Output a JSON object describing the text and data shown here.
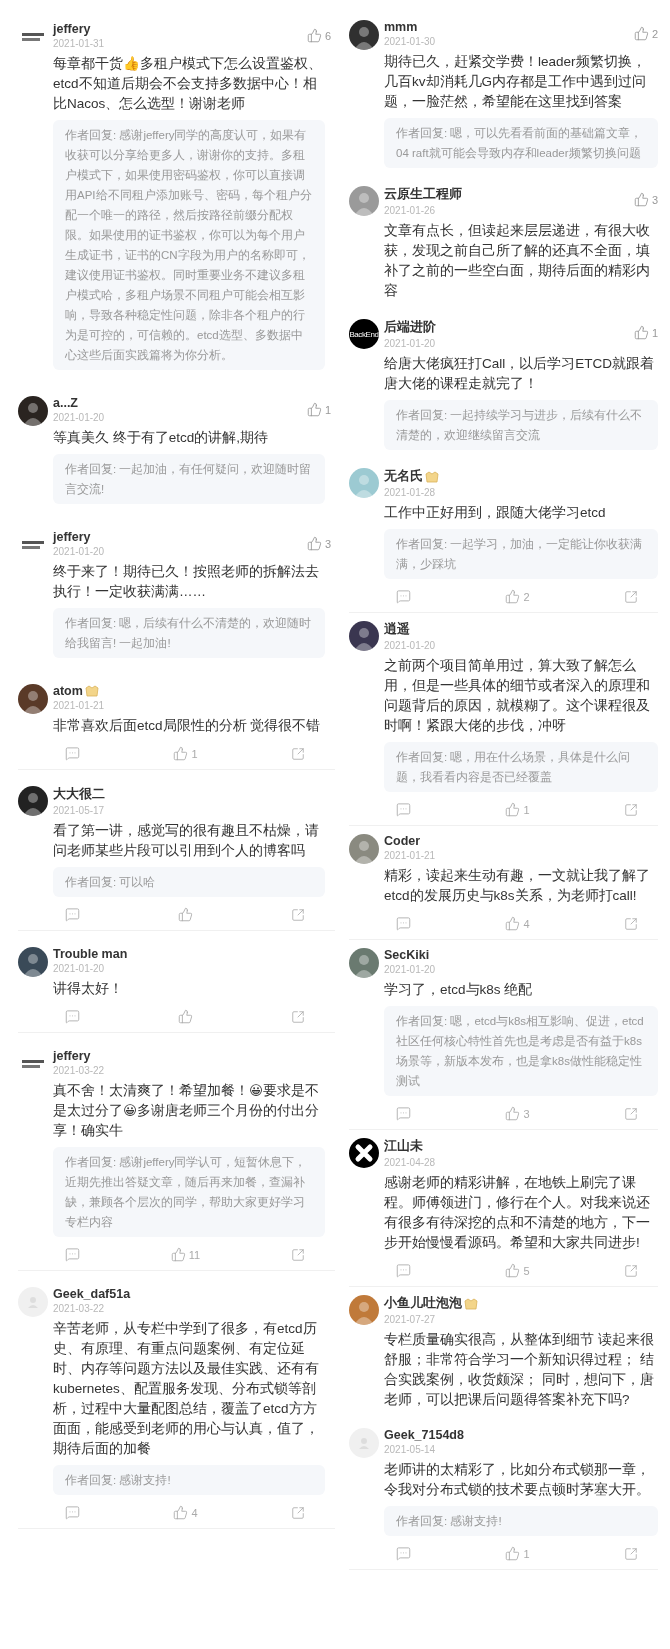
{
  "columns": [
    {
      "comments": [
        {
          "author": "jeffery",
          "badge": false,
          "date": "2021-01-31",
          "avatar": {
            "kind": "wordmark"
          },
          "header_likes": "6",
          "footer": false,
          "text": "每章都干货👍多租户模式下怎么设置鉴权、etcd不知道后期会不会支持多数据中心！相比Nacos、怎么选型！谢谢老师",
          "reply": "作者回复: 感谢jeffery同学的高度认可，如果有收获可以分享给更多人，谢谢你的支持。多租户模式下，如果使用密码鉴权，你可以直接调用API给不同租户添加账号、密码，每个租户分配一个唯一的路径，然后按路径前缀分配权限。如果使用的证书鉴权，你可以为每个用户生成证书，证书的CN字段为用户的名称即可，建议使用证书鉴权。同时重要业务不建议多租户模式哈，多租户场景不同租户可能会相互影响，导致各种稳定性问题，除非各个租户的行为是可控的，可信赖的。etcd选型、多数据中心这些后面实践篇将为你分析。"
        },
        {
          "author": "a...Z",
          "badge": false,
          "date": "2021-01-20",
          "avatar": {
            "kind": "photo",
            "color": "#2a2420"
          },
          "header_likes": "1",
          "footer": false,
          "text": "等真美久 终于有了etcd的讲解,期待",
          "reply": "作者回复: 一起加油，有任何疑问，欢迎随时留言交流!"
        },
        {
          "author": "jeffery",
          "badge": false,
          "date": "2021-01-20",
          "avatar": {
            "kind": "wordmark"
          },
          "header_likes": "3",
          "footer": false,
          "text": "终于来了！期待已久！按照老师的拆解法去执行！一定收获满满……",
          "reply": "作者回复: 嗯，后续有什么不清楚的，欢迎随时给我留言! 一起加油!"
        },
        {
          "author": "atom",
          "badge": true,
          "date": "2021-01-21",
          "avatar": {
            "kind": "photo",
            "color": "#5a3a28"
          },
          "text": "非常喜欢后面etcd局限性的分析 觉得很不错",
          "footer": true,
          "footer_likes": "1"
        },
        {
          "author": "大大很二",
          "badge": false,
          "date": "2021-05-17",
          "avatar": {
            "kind": "photo",
            "color": "#222222"
          },
          "text": "看了第一讲，感觉写的很有趣且不枯燥，请问老师某些片段可以引用到个人的博客吗",
          "reply": "作者回复: 可以哈",
          "footer": true
        },
        {
          "author": "Trouble man",
          "badge": false,
          "date": "2021-01-20",
          "avatar": {
            "kind": "photo",
            "color": "#3a4a58"
          },
          "text": "讲得太好！",
          "footer": true
        },
        {
          "author": "jeffery",
          "badge": false,
          "date": "2021-03-22",
          "avatar": {
            "kind": "wordmark"
          },
          "text": "真不舍！太清爽了！希望加餐！😀要求是不是太过分了😀多谢唐老师三个月份的付出分享！确实牛",
          "reply": "作者回复: 感谢jeffery同学认可，短暂休息下，近期先推出答疑文章，随后再来加餐，查漏补缺，兼顾各个层次的同学，帮助大家更好学习专栏内容",
          "footer": true,
          "footer_likes": "11"
        },
        {
          "author": "Geek_daf51a",
          "badge": false,
          "date": "2021-03-22",
          "avatar": {
            "kind": "default"
          },
          "text": "辛苦老师，从专栏中学到了很多，有etcd历史、有原理、有重点问题案例、有定位延时、内存等问题方法以及最佳实践、还有有kubernetes、配置服务发现、分布式锁等剖析，过程中大量配图总结，覆盖了etcd方方面面，能感受到老师的用心与认真，值了，期待后面的加餐",
          "reply": "作者回复: 感谢支持!",
          "footer": true,
          "footer_likes": "4"
        }
      ]
    },
    {
      "comments": [
        {
          "author": "mmm",
          "badge": false,
          "date": "2021-01-30",
          "avatar": {
            "kind": "photo",
            "color": "#303030"
          },
          "header_likes": "2",
          "footer": false,
          "text": "期待已久，赶紧交学费！leader频繁切换，几百kv却消耗几G内存都是工作中遇到过问题，一脸茫然，希望能在这里找到答案",
          "reply": "作者回复: 嗯，可以先看看前面的基础篇文章，04 raft就可能会导致内存和leader频繁切换问题"
        },
        {
          "author": "云原生工程师",
          "badge": false,
          "date": "2021-01-26",
          "avatar": {
            "kind": "photo",
            "color": "#9a9a9a"
          },
          "header_likes": "3",
          "footer": false,
          "text": "文章有点长，但读起来层层递进，有很大收获，发现之前自己所了解的还真不全面，填补了之前的一些空白面，期待后面的精彩内容"
        },
        {
          "author": "后端进阶",
          "badge": false,
          "date": "2021-01-20",
          "avatar": {
            "kind": "logo",
            "label": "BackEnd"
          },
          "header_likes": "1",
          "footer": false,
          "text": "给唐大佬疯狂打Call，以后学习ETCD就跟着唐大佬的课程走就完了！",
          "reply": "作者回复: 一起持续学习与进步，后续有什么不清楚的，欢迎继续留言交流"
        },
        {
          "author": "无名氏",
          "badge": true,
          "date": "2021-01-28",
          "avatar": {
            "kind": "photo",
            "color": "#9ccad2"
          },
          "text": "工作中正好用到，跟随大佬学习etcd",
          "reply": "作者回复: 一起学习，加油，一定能让你收获满满，少踩坑",
          "footer": true,
          "footer_likes": "2"
        },
        {
          "author": "逍遥",
          "badge": false,
          "date": "2021-01-20",
          "avatar": {
            "kind": "photo",
            "color": "#3a3650"
          },
          "text": "之前两个项目简单用过，算大致了解怎么用，但是一些具体的细节或者深入的原理和问题背后的原因，就模糊了。这个课程很及时啊！紧跟大佬的步伐，冲呀",
          "reply": "作者回复: 嗯，用在什么场景，具体是什么问题，我看看内容是否已经覆盖",
          "footer": true,
          "footer_likes": "1"
        },
        {
          "author": "Coder",
          "badge": false,
          "date": "2021-01-21",
          "avatar": {
            "kind": "photo",
            "color": "#8a8a80"
          },
          "text": "精彩，读起来生动有趣，一文就让我了解了etcd的发展历史与k8s关系，为老师打call!",
          "footer": true,
          "footer_likes": "4"
        },
        {
          "author": "SecKiki",
          "badge": false,
          "date": "2021-01-20",
          "avatar": {
            "kind": "photo",
            "color": "#6a7a70"
          },
          "text": "学习了，etcd与k8s 绝配",
          "reply": "作者回复: 嗯，etcd与k8s相互影响、促进，etcd社区任何核心特性首先也是考虑是否有益于k8s场景等，新版本发布，也是拿k8s做性能稳定性测试",
          "footer": true,
          "footer_likes": "3"
        },
        {
          "author": "江山未",
          "badge": false,
          "date": "2021-04-28",
          "avatar": {
            "kind": "cross"
          },
          "text": "感谢老师的精彩讲解，在地铁上刷完了课程。师傅领进门，修行在个人。对我来说还有很多有待深挖的点和不清楚的地方，下一步开始慢慢看源码。希望和大家共同进步!",
          "footer": true,
          "footer_likes": "5"
        },
        {
          "author": "小鱼儿吐泡泡",
          "badge": true,
          "date": "2021-07-27",
          "avatar": {
            "kind": "photo",
            "color": "#c07a3a"
          },
          "footer": false,
          "text": "专栏质量确实很高，从整体到细节 读起来很舒服；非常符合学习一个新知识得过程； 结合实践案例，收货颇深； 同时，想问下，唐老师，可以把课后问题得答案补充下吗?"
        },
        {
          "author": "Geek_7154d8",
          "badge": false,
          "date": "2021-05-14",
          "avatar": {
            "kind": "default"
          },
          "text": "老师讲的太精彩了，比如分布式锁那一章，令我对分布式锁的技术要点顿时茅塞大开。",
          "reply": "作者回复: 感谢支持!",
          "footer": true,
          "footer_likes": "1"
        }
      ]
    }
  ]
}
